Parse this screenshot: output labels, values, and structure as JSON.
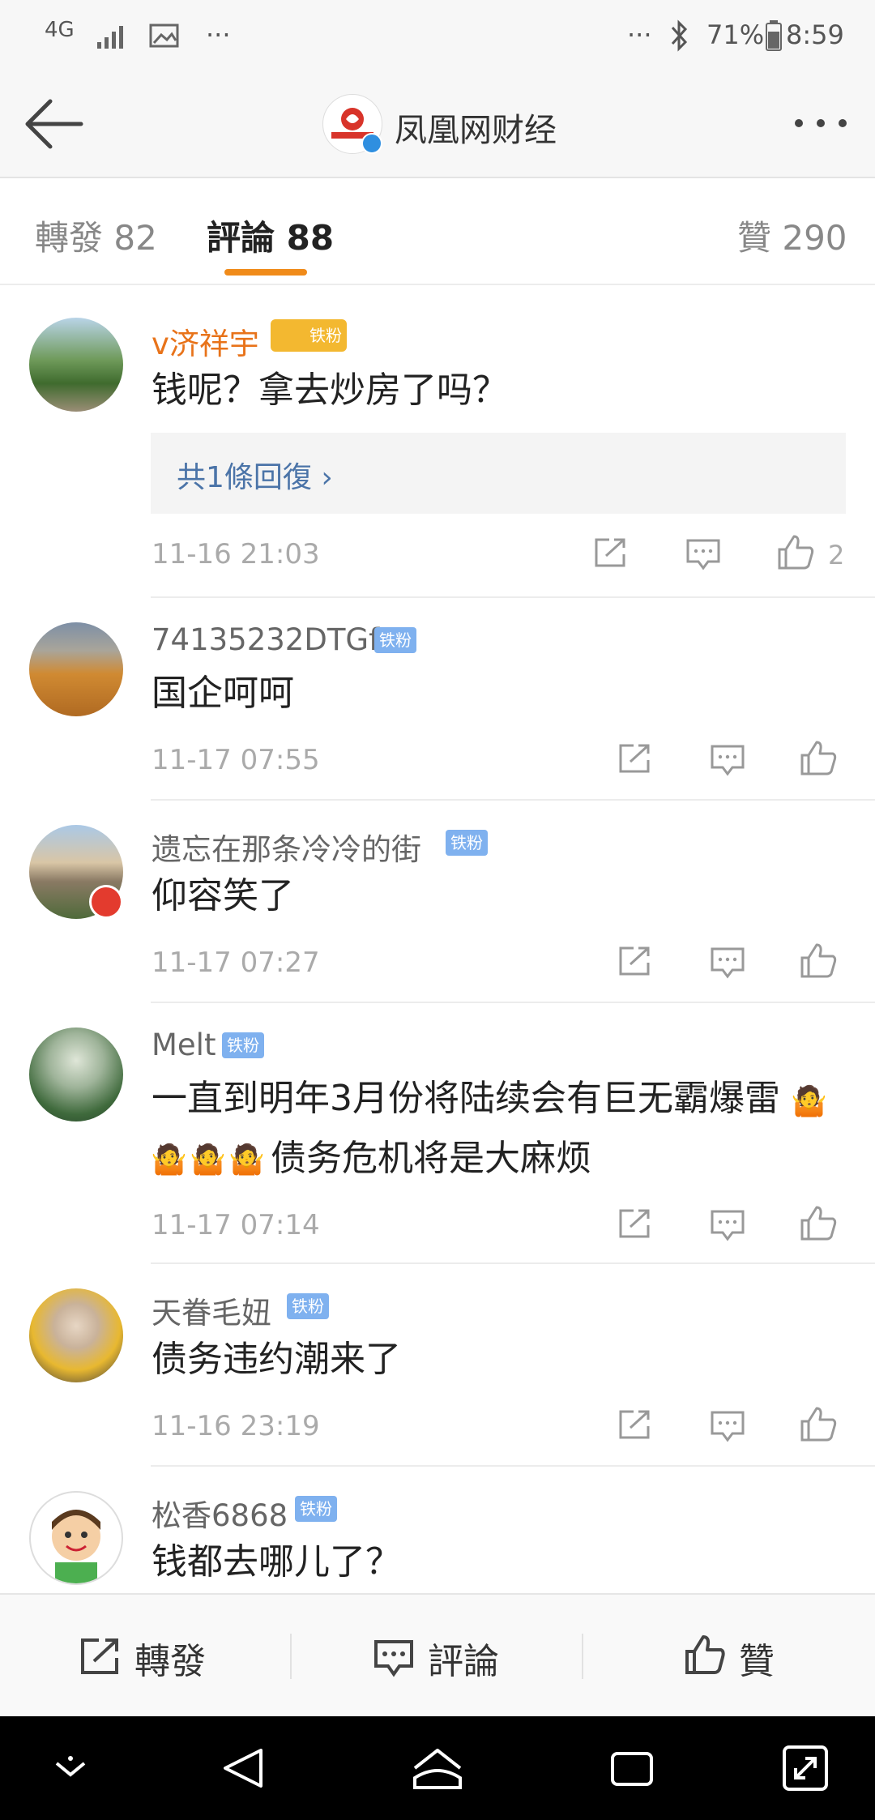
{
  "status_bar": {
    "network": "4G",
    "battery": "71%",
    "time": "8:59",
    "dots": "···"
  },
  "header": {
    "title": "凤凰网财经"
  },
  "tabs": [
    {
      "label": "轉發 82"
    },
    {
      "label": "評論 88"
    },
    {
      "label": "贊 290"
    }
  ],
  "comments": [
    {
      "username": "v济祥宇",
      "badge": "铁粉",
      "text": "钱呢？拿去炒房了吗？",
      "reply_summary": "共1條回復 ›",
      "time": "11-16 21:03",
      "likes": "2"
    },
    {
      "username": "74135232DTGf",
      "badge": "铁粉",
      "text": "国企呵呵",
      "time": "11-17 07:55"
    },
    {
      "username": "遗忘在那条冷冷的街",
      "badge": "铁粉",
      "text": "仰容笑了",
      "time": "11-17 07:27"
    },
    {
      "username": "Melt",
      "badge": "铁粉",
      "text_line1": "一直到明年3月份将陆续会有巨无霸爆雷",
      "text_line2": "债务危机将是大麻烦",
      "time": "11-17 07:14"
    },
    {
      "username": "天眷毛妞",
      "badge": "铁粉",
      "text": "债务违约潮来了",
      "time": "11-16 23:19"
    },
    {
      "username": "松香6868",
      "badge": "铁粉",
      "text": "钱都去哪儿了？"
    }
  ],
  "bottom_bar": {
    "repost": "轉發",
    "comment": "評論",
    "like": "贊"
  },
  "colors": {
    "accent": "#f08b1a",
    "link": "#4b74a8",
    "badge": "#7fb1ef"
  }
}
